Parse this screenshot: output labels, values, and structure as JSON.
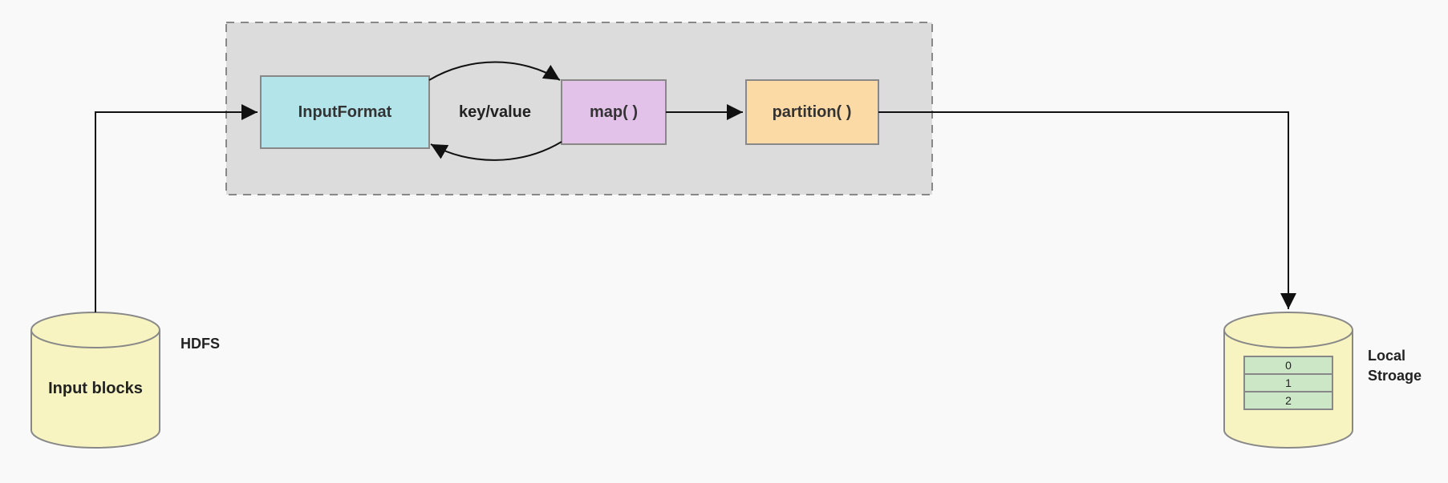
{
  "nodes": {
    "input_blocks": {
      "label": "Input blocks",
      "side_label": "HDFS",
      "fill": "#f7f4c1"
    },
    "container": {
      "fill": "#dcdcdc"
    },
    "input_format": {
      "label": "InputFormat",
      "fill": "#b3e4ea"
    },
    "kv_label": {
      "label": "key/value"
    },
    "map": {
      "label": "map( )",
      "fill": "#e3c2ea"
    },
    "partition": {
      "label": "partition( )",
      "fill": "#fbdaa5"
    },
    "local_storage": {
      "side_label_line1": "Local",
      "side_label_line2": "Stroage",
      "fill": "#f7f4c1",
      "slots": [
        "0",
        "1",
        "2"
      ],
      "slot_fill": "#cce7c6"
    }
  }
}
